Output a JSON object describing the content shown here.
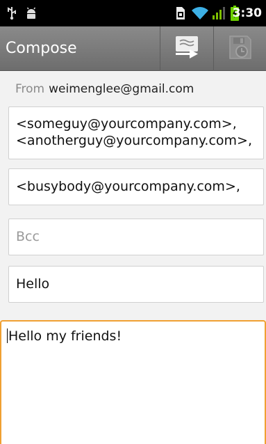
{
  "status_bar": {
    "time": "3:30",
    "icons": [
      "usb-icon",
      "android-debug-icon",
      "sim-icon",
      "wifi-icon",
      "signal-icon",
      "battery-charging-icon"
    ]
  },
  "action_bar": {
    "title": "Compose",
    "actions": [
      {
        "name": "send-icon",
        "label": "Send"
      },
      {
        "name": "save-draft-icon",
        "label": "Save draft"
      }
    ]
  },
  "compose": {
    "from_label": "From",
    "from_value": "weimenglee@gmail.com",
    "to_lines": [
      "<someguy@yourcompany.com>,",
      "<anotherguy@yourcompany.com>,"
    ],
    "cc_value": "<busybody@yourcompany.com>,",
    "bcc_placeholder": "Bcc",
    "subject_value": "Hello",
    "body_value": "Hello my friends!"
  },
  "colors": {
    "action_bar": "#7a7a7a",
    "focus_border": "#f0a032",
    "battery_charging": "#6cd000"
  }
}
